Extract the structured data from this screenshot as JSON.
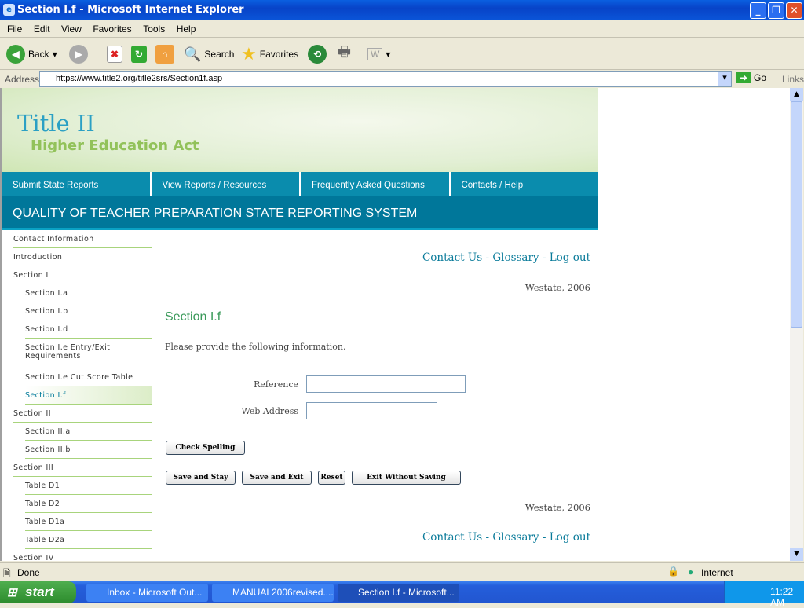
{
  "window": {
    "title": "Section I.f - Microsoft Internet Explorer"
  },
  "menu": [
    "File",
    "Edit",
    "View",
    "Favorites",
    "Tools",
    "Help"
  ],
  "toolbar": {
    "back": "Back",
    "search": "Search",
    "favorites": "Favorites"
  },
  "address": {
    "label": "Address",
    "url": "https://www.title2.org/title2srs/Section1f.asp",
    "go": "Go",
    "links": "Links"
  },
  "banner": {
    "logo_line1": "Title II",
    "logo_line2": "Higher Education Act"
  },
  "nav": [
    "Submit State Reports",
    "View Reports / Resources",
    "Frequently Asked Questions",
    "Contacts / Help"
  ],
  "system_title": "QUALITY OF TEACHER PREPARATION STATE REPORTING SYSTEM",
  "sidebar": [
    {
      "label": "Contact Information",
      "level": 1
    },
    {
      "label": "Introduction",
      "level": 1
    },
    {
      "label": "Section I",
      "level": 1
    },
    {
      "label": "Section I.a",
      "level": 2
    },
    {
      "label": "Section I.b",
      "level": 2
    },
    {
      "label": "Section I.d",
      "level": 2
    },
    {
      "label": "Section I.e Entry/Exit Requirements",
      "level": 2
    },
    {
      "label": "Section I.e Cut Score Table",
      "level": 2
    },
    {
      "label": "Section I.f",
      "level": 2,
      "active": true
    },
    {
      "label": "Section II",
      "level": 1
    },
    {
      "label": "Section II.a",
      "level": 2
    },
    {
      "label": "Section II.b",
      "level": 2
    },
    {
      "label": "Section III",
      "level": 1
    },
    {
      "label": "Table D1",
      "level": 2
    },
    {
      "label": "Table D2",
      "level": 2
    },
    {
      "label": "Table D1a",
      "level": 2
    },
    {
      "label": "Table D2a",
      "level": 2
    },
    {
      "label": "Section IV",
      "level": 1
    }
  ],
  "main": {
    "links": {
      "contact": "Contact Us",
      "glossary": "Glossary",
      "logout": "Log out",
      "sep": " - "
    },
    "state_year": "Westate, 2006",
    "heading": "Section I.f",
    "instructions": "Please provide the following information.",
    "fields": {
      "reference_label": "Reference",
      "reference_value": "",
      "web_label": "Web Address",
      "web_value": ""
    },
    "buttons": {
      "spell": "Check Spelling",
      "save_stay": "Save and Stay",
      "save_exit": "Save and Exit",
      "reset": "Reset",
      "exit_nosave": "Exit Without Saving"
    }
  },
  "status": {
    "text": "Done",
    "zone": "Internet"
  },
  "taskbar": {
    "start": "start",
    "tasks": [
      "Inbox - Microsoft Out...",
      "MANUAL2006revised....",
      "Section I.f - Microsoft..."
    ],
    "clock": "11:22 AM"
  }
}
